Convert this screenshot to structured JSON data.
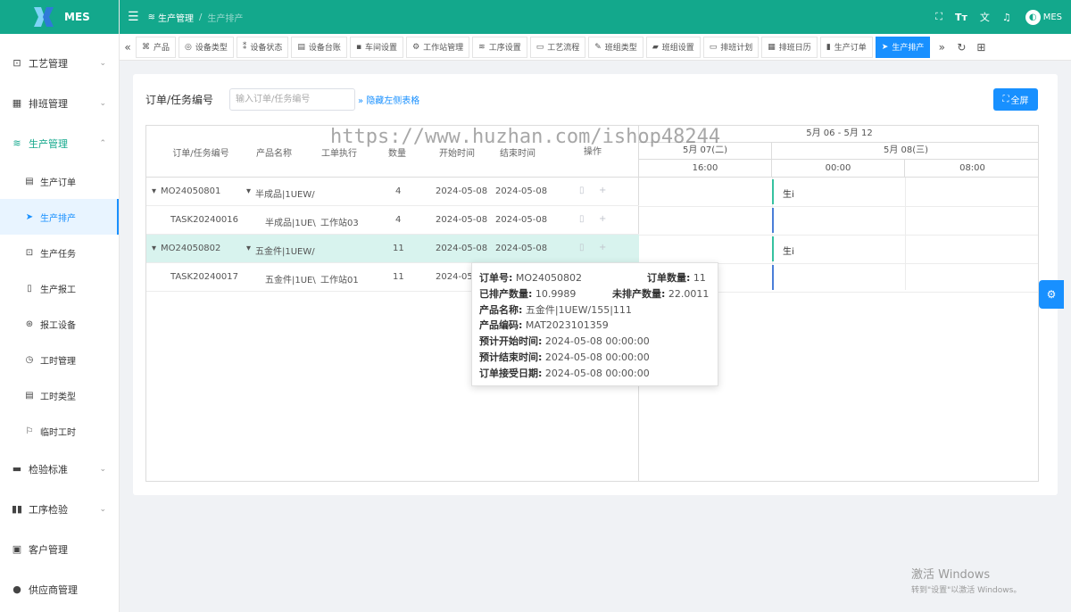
{
  "app": {
    "title": "MES"
  },
  "colors": {
    "primary": "#13a88c",
    "accent": "#1890ff",
    "bar_green": "#36c2a0",
    "bar_blue": "#4a7ed8"
  },
  "topbar": {
    "breadcrumb": [
      "生产管理",
      "生产排产"
    ],
    "user": "MES"
  },
  "sidebar": {
    "items": [
      {
        "label": "工艺管理",
        "icon": "briefcase-icon",
        "expandable": true
      },
      {
        "label": "排班管理",
        "icon": "calendar-icon",
        "expandable": true
      },
      {
        "label": "生产管理",
        "icon": "database-icon",
        "expandable": true,
        "open": true,
        "children": [
          {
            "label": "生产订单",
            "icon": "clipboard-icon"
          },
          {
            "label": "生产排产",
            "icon": "send-icon",
            "active": true
          },
          {
            "label": "生产任务",
            "icon": "briefcase-icon"
          },
          {
            "label": "生产报工",
            "icon": "phone-icon"
          },
          {
            "label": "报工设备",
            "icon": "dribbble-icon"
          },
          {
            "label": "工时管理",
            "icon": "clock-icon"
          },
          {
            "label": "工时类型",
            "icon": "document-icon"
          },
          {
            "label": "临时工时",
            "icon": "flag-icon"
          }
        ]
      },
      {
        "label": "检验标准",
        "icon": "monitor-icon",
        "expandable": true
      },
      {
        "label": "工序检验",
        "icon": "book-icon",
        "expandable": true
      },
      {
        "label": "客户管理",
        "icon": "contact-icon"
      },
      {
        "label": "供应商管理",
        "icon": "user-icon"
      }
    ]
  },
  "tabs": [
    {
      "label": "产品",
      "icon": "gift-icon"
    },
    {
      "label": "设备类型",
      "icon": "target-icon"
    },
    {
      "label": "设备状态",
      "icon": "sliders-icon"
    },
    {
      "label": "设备台账",
      "icon": "server-icon"
    },
    {
      "label": "车间设置",
      "icon": "grid-icon"
    },
    {
      "label": "工作站管理",
      "icon": "gears-icon"
    },
    {
      "label": "工序设置",
      "icon": "database-icon"
    },
    {
      "label": "工艺流程",
      "icon": "folder-icon"
    },
    {
      "label": "班组类型",
      "icon": "pen-icon"
    },
    {
      "label": "班组设置",
      "icon": "book-icon"
    },
    {
      "label": "排班计划",
      "icon": "message-icon"
    },
    {
      "label": "排班日历",
      "icon": "calendar-icon"
    },
    {
      "label": "生产订单",
      "icon": "clipboard-icon"
    },
    {
      "label": "生产排产",
      "icon": "send-icon",
      "active": true
    }
  ],
  "search": {
    "label": "订单/任务编号",
    "placeholder": "输入订单/任务编号",
    "hide_link": "隐藏左侧表格",
    "fullscreen": "全屏"
  },
  "grid": {
    "headers": [
      "订单/任务编号",
      "产品名称",
      "工单执行",
      "数量",
      "开始时间",
      "结束时间",
      "操作"
    ],
    "rows": [
      {
        "code": "MO24050801",
        "product": "半成品|1UEW/",
        "station": "",
        "qty": "4",
        "start": "2024-05-08",
        "end": "2024-05-08",
        "parent": true
      },
      {
        "code": "TASK20240016",
        "product": "半成品|1UE\\",
        "station": "工作站03",
        "qty": "4",
        "start": "2024-05-08",
        "end": "2024-05-08",
        "parent": false
      },
      {
        "code": "MO24050802",
        "product": "五金件|1UEW/",
        "station": "",
        "qty": "11",
        "start": "2024-05-08",
        "end": "2024-05-08",
        "parent": true,
        "selected": true
      },
      {
        "code": "TASK20240017",
        "product": "五金件|1UE\\",
        "station": "工作站01",
        "qty": "11",
        "start": "2024-05-0",
        "end": "",
        "parent": false
      }
    ]
  },
  "timeline": {
    "week": "5月 06 - 5月 12",
    "days": [
      "5月 07(二)",
      "5月 08(三)"
    ],
    "hours": [
      "16:00",
      "00:00",
      "08:00"
    ],
    "bar_labels": [
      "生i",
      "生i"
    ]
  },
  "tooltip": {
    "order_no_label": "订单号:",
    "order_no": "MO24050802",
    "order_qty_label": "订单数量:",
    "order_qty": "11",
    "scheduled_label": "已排产数量:",
    "scheduled": "10.9989",
    "unscheduled_label": "未排产数量:",
    "unscheduled": "22.0011",
    "product_name_label": "产品名称:",
    "product_name": "五金件|1UEW/155|111",
    "product_code_label": "产品编码:",
    "product_code": "MAT2023101359",
    "plan_start_label": "预计开始时间:",
    "plan_start": "2024-05-08 00:00:00",
    "plan_end_label": "预计结束时间:",
    "plan_end": "2024-05-08 00:00:00",
    "accept_label": "订单接受日期:",
    "accept": "2024-05-08 00:00:00"
  },
  "watermark": "https://www.huzhan.com/ishop48244",
  "windows": {
    "line1": "激活 Windows",
    "line2": "转到\"设置\"以激活 Windows。"
  }
}
